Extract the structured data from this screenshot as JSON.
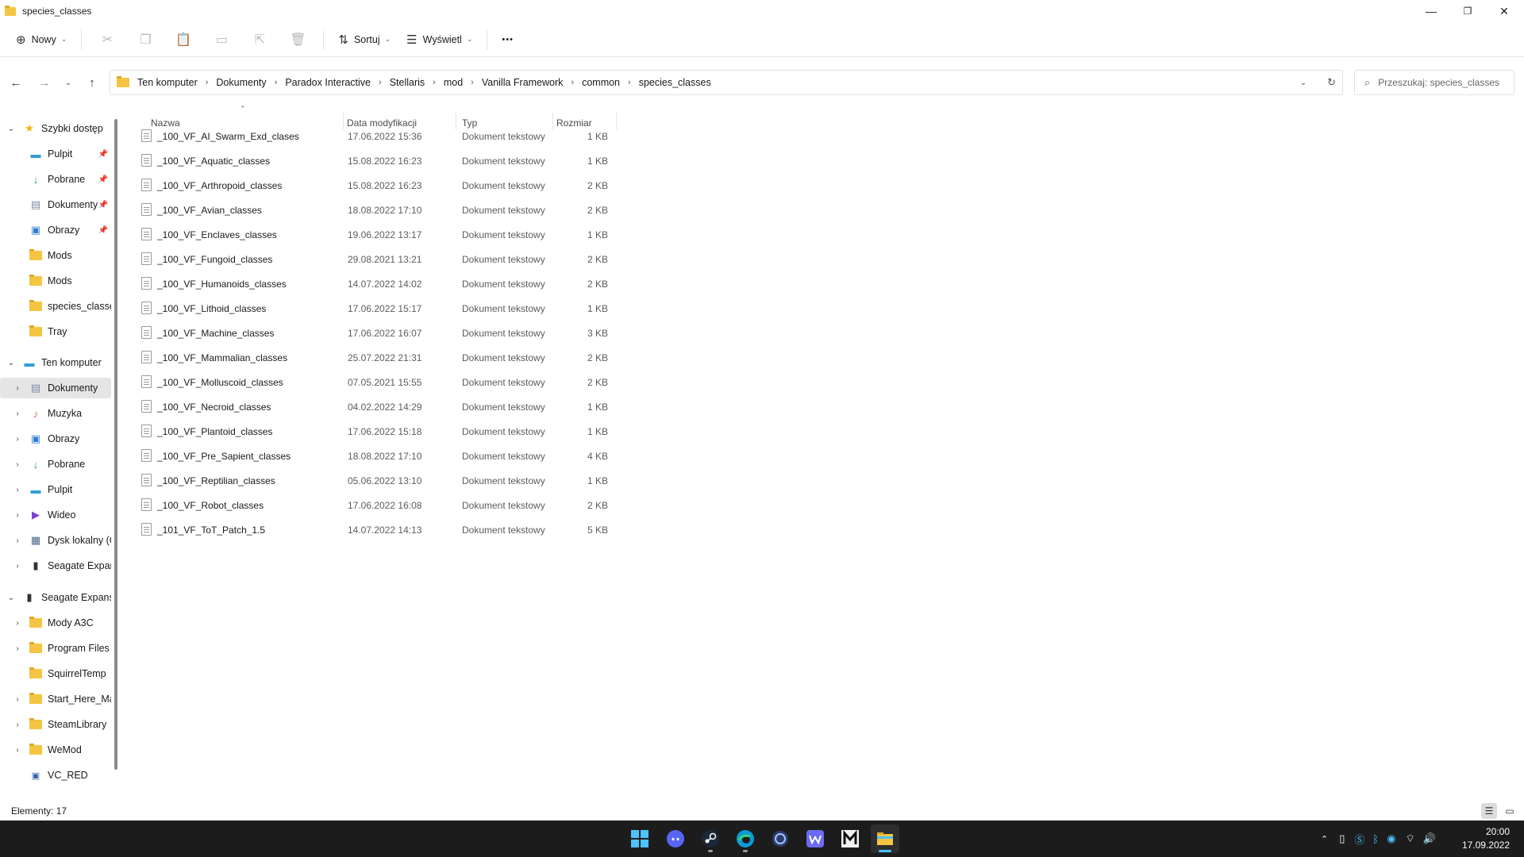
{
  "window": {
    "title": "species_classes",
    "minimize_glyph": "—",
    "restore_glyph": "❐",
    "close_glyph": "✕"
  },
  "toolbar": {
    "new_label": "Nowy",
    "sort_label": "Sortuj",
    "view_label": "Wyświetl",
    "more_label": "•••"
  },
  "address": {
    "crumbs": [
      "Ten komputer",
      "Dokumenty",
      "Paradox Interactive",
      "Stellaris",
      "mod",
      "Vanilla Framework",
      "common",
      "species_classes"
    ],
    "search_placeholder": "Przeszukaj: species_classes"
  },
  "sidebar": {
    "quick_access": {
      "label": "Szybki dostęp"
    },
    "quick_items": [
      {
        "label": "Pulpit",
        "icon": "desktop-icon",
        "pinned": true
      },
      {
        "label": "Pobrane",
        "icon": "download-icon",
        "pinned": true
      },
      {
        "label": "Dokumenty",
        "icon": "documents-icon",
        "pinned": true
      },
      {
        "label": "Obrazy",
        "icon": "pictures-icon",
        "pinned": true
      },
      {
        "label": "Mods",
        "icon": "folder-icon",
        "pinned": false
      },
      {
        "label": "Mods",
        "icon": "folder-icon",
        "pinned": false
      },
      {
        "label": "species_classes",
        "icon": "folder-icon",
        "pinned": false
      },
      {
        "label": "Tray",
        "icon": "folder-icon",
        "pinned": false
      }
    ],
    "this_pc": {
      "label": "Ten komputer"
    },
    "pc_items": [
      {
        "label": "Dokumenty",
        "icon": "documents-icon",
        "selected": true
      },
      {
        "label": "Muzyka",
        "icon": "music-icon"
      },
      {
        "label": "Obrazy",
        "icon": "pictures-icon"
      },
      {
        "label": "Pobrane",
        "icon": "download-icon"
      },
      {
        "label": "Pulpit",
        "icon": "desktop-icon"
      },
      {
        "label": "Wideo",
        "icon": "video-icon"
      },
      {
        "label": "Dysk lokalny (C",
        "icon": "drive-icon"
      },
      {
        "label": "Seagate Expans",
        "icon": "external-drive-icon"
      }
    ],
    "seagate": {
      "label": "Seagate Expansic"
    },
    "seagate_items": [
      {
        "label": "Mody A3C",
        "has_children": true
      },
      {
        "label": "Program Files (",
        "has_children": true
      },
      {
        "label": "SquirrelTemp",
        "has_children": false
      },
      {
        "label": "Start_Here_Mac",
        "has_children": true
      },
      {
        "label": "SteamLibrary",
        "has_children": true
      },
      {
        "label": "WeMod",
        "has_children": true
      },
      {
        "label": "VC_RED",
        "has_children": false
      }
    ]
  },
  "columns": {
    "name": "Nazwa",
    "date": "Data modyfikacji",
    "type": "Typ",
    "size": "Rozmiar"
  },
  "files": [
    {
      "name": "_100_VF_AI_Swarm_Exd_clases",
      "date": "17.06.2022 15:36",
      "type": "Dokument tekstowy",
      "size": "1 KB"
    },
    {
      "name": "_100_VF_Aquatic_classes",
      "date": "15.08.2022 16:23",
      "type": "Dokument tekstowy",
      "size": "1 KB"
    },
    {
      "name": "_100_VF_Arthropoid_classes",
      "date": "15.08.2022 16:23",
      "type": "Dokument tekstowy",
      "size": "2 KB"
    },
    {
      "name": "_100_VF_Avian_classes",
      "date": "18.08.2022 17:10",
      "type": "Dokument tekstowy",
      "size": "2 KB"
    },
    {
      "name": "_100_VF_Enclaves_classes",
      "date": "19.06.2022 13:17",
      "type": "Dokument tekstowy",
      "size": "1 KB"
    },
    {
      "name": "_100_VF_Fungoid_classes",
      "date": "29.08.2021 13:21",
      "type": "Dokument tekstowy",
      "size": "2 KB"
    },
    {
      "name": "_100_VF_Humanoids_classes",
      "date": "14.07.2022 14:02",
      "type": "Dokument tekstowy",
      "size": "2 KB"
    },
    {
      "name": "_100_VF_Lithoid_classes",
      "date": "17.06.2022 15:17",
      "type": "Dokument tekstowy",
      "size": "1 KB"
    },
    {
      "name": "_100_VF_Machine_classes",
      "date": "17.06.2022 16:07",
      "type": "Dokument tekstowy",
      "size": "3 KB"
    },
    {
      "name": "_100_VF_Mammalian_classes",
      "date": "25.07.2022 21:31",
      "type": "Dokument tekstowy",
      "size": "2 KB"
    },
    {
      "name": "_100_VF_Molluscoid_classes",
      "date": "07.05.2021 15:55",
      "type": "Dokument tekstowy",
      "size": "2 KB"
    },
    {
      "name": "_100_VF_Necroid_classes",
      "date": "04.02.2022 14:29",
      "type": "Dokument tekstowy",
      "size": "1 KB"
    },
    {
      "name": "_100_VF_Plantoid_classes",
      "date": "17.06.2022 15:18",
      "type": "Dokument tekstowy",
      "size": "1 KB"
    },
    {
      "name": "_100_VF_Pre_Sapient_classes",
      "date": "18.08.2022 17:10",
      "type": "Dokument tekstowy",
      "size": "4 KB"
    },
    {
      "name": "_100_VF_Reptilian_classes",
      "date": "05.06.2022 13:10",
      "type": "Dokument tekstowy",
      "size": "1 KB"
    },
    {
      "name": "_100_VF_Robot_classes",
      "date": "17.06.2022 16:08",
      "type": "Dokument tekstowy",
      "size": "2 KB"
    },
    {
      "name": "_101_VF_ToT_Patch_1.5",
      "date": "14.07.2022 14:13",
      "type": "Dokument tekstowy",
      "size": "5 KB"
    }
  ],
  "status": {
    "items_count": "Elementy: 17"
  },
  "taskbar": {
    "apps": [
      {
        "name": "start-icon",
        "active": false
      },
      {
        "name": "discord-icon",
        "active": false
      },
      {
        "name": "steam-icon",
        "active": false,
        "running": true
      },
      {
        "name": "edge-icon",
        "active": false,
        "running": true
      },
      {
        "name": "app-circle-icon",
        "active": false
      },
      {
        "name": "wattpad-icon",
        "active": false
      },
      {
        "name": "m-app-icon",
        "active": false
      },
      {
        "name": "file-explorer-icon",
        "active": true
      }
    ],
    "time": "20:00",
    "date": "17.09.2022"
  },
  "colors": {
    "accent": "#4cc2ff",
    "folder": "#f4c542",
    "taskbar_bg": "#1c1c1c",
    "selection": "#e5e5e5"
  }
}
